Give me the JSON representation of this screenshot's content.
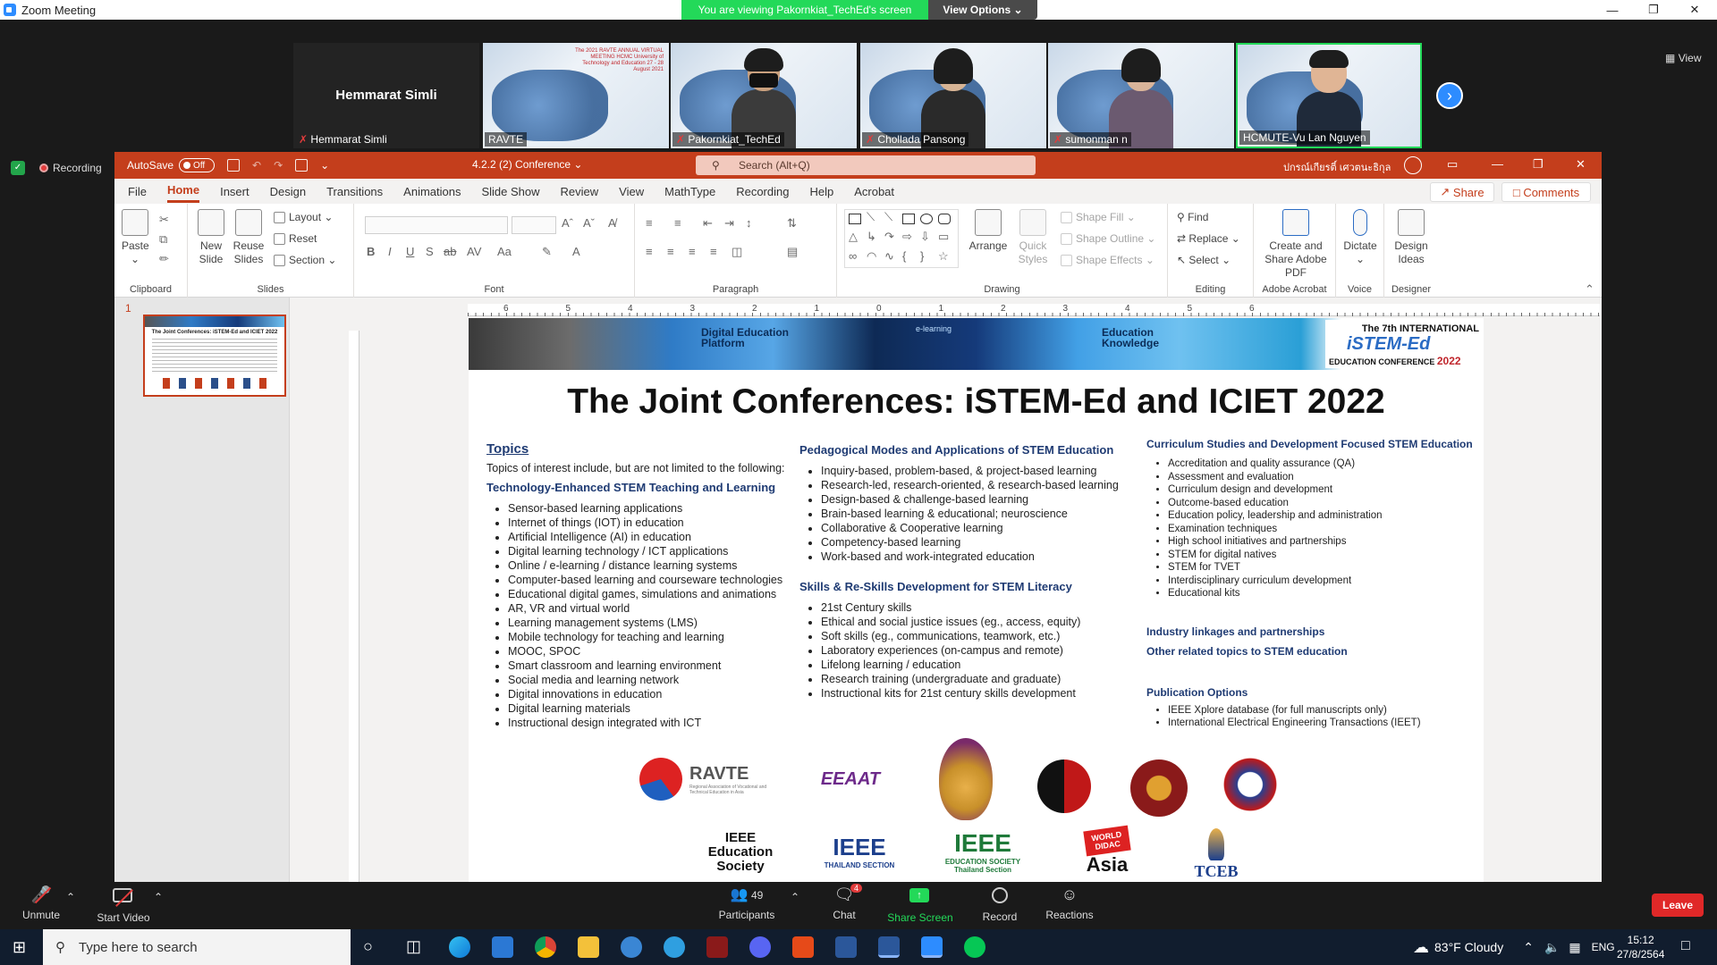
{
  "zoom": {
    "window_title": "Zoom Meeting",
    "viewing_banner": "You are viewing Pakornkiat_TechEd's screen",
    "view_options": "View Options",
    "view_button": "View",
    "recording_label": "Recording",
    "participants_tiles": [
      {
        "name": "Hemmarat Simli",
        "label": "Hemmarat Simli",
        "type": "name-only"
      },
      {
        "name": "RAVTE",
        "type": "slide"
      },
      {
        "name": "Pakornkiat_TechEd",
        "type": "person-mask"
      },
      {
        "name": "Chollada Pansong",
        "type": "person"
      },
      {
        "name": "sumonman n",
        "type": "person"
      },
      {
        "name": "HCMUTE-Vu Lan Nguyen",
        "type": "person"
      }
    ],
    "tile_slide_title": "The 2021 RAVTE ANNUAL VIRTUAL MEETING HCMC University of Technology and Education 27 - 28 August 2021",
    "toolbar": {
      "unmute": "Unmute",
      "start_video": "Start Video",
      "participants": "Participants",
      "participants_count": "49",
      "chat": "Chat",
      "chat_badge": "4",
      "share_screen": "Share Screen",
      "record": "Record",
      "reactions": "Reactions",
      "leave": "Leave"
    }
  },
  "ppt": {
    "autosave": "AutoSave",
    "autosave_state": "Off",
    "doc_name": "4.2.2 (2) Conference",
    "search_placeholder": "Search (Alt+Q)",
    "user_name": "ปกรณ์เกียรติ์ เศวตนะธิกุล",
    "menu": [
      "File",
      "Home",
      "Insert",
      "Design",
      "Transitions",
      "Animations",
      "Slide Show",
      "Review",
      "View",
      "MathType",
      "Recording",
      "Help",
      "Acrobat"
    ],
    "active_menu": "Home",
    "share": "Share",
    "comments": "Comments",
    "ribbon": {
      "clipboard": {
        "label": "Clipboard",
        "paste": "Paste"
      },
      "slides": {
        "label": "Slides",
        "new_slide": "New Slide",
        "reuse": "Reuse Slides",
        "layout": "Layout",
        "reset": "Reset",
        "section": "Section"
      },
      "font": {
        "label": "Font"
      },
      "paragraph": {
        "label": "Paragraph"
      },
      "drawing": {
        "label": "Drawing",
        "arrange": "Arrange",
        "quick_styles": "Quick Styles",
        "shape_fill": "Shape Fill",
        "shape_outline": "Shape Outline",
        "shape_effects": "Shape Effects"
      },
      "editing": {
        "label": "Editing",
        "find": "Find",
        "replace": "Replace",
        "select": "Select"
      },
      "acrobat": {
        "label": "Adobe Acrobat",
        "create": "Create and Share Adobe PDF"
      },
      "voice": {
        "label": "Voice",
        "dictate": "Dictate"
      },
      "designer": {
        "label": "Designer",
        "ideas": "Design Ideas"
      }
    },
    "ruler_ticks": [
      "6",
      "5",
      "4",
      "3",
      "2",
      "1",
      "0",
      "1",
      "2",
      "3",
      "4",
      "5",
      "6"
    ],
    "slide_number": "1",
    "thumb_title": "The Joint Conferences: iSTEM-Ed and ICIET 2022"
  },
  "slide": {
    "banner": {
      "digital_platform": "Digital Education Platform",
      "knowledge": "Education Knowledge",
      "elearning": "e-learning",
      "conf_line1": "The 7th INTERNATIONAL",
      "conf_logo": "iSTEM-Ed",
      "conf_line2": "EDUCATION CONFERENCE",
      "conf_year": "2022"
    },
    "title": "The Joint Conferences: iSTEM-Ed and ICIET 2022",
    "col1": {
      "topics": "Topics",
      "intro": "Topics of interest include, but are not limited to the following:",
      "heading": "Technology-Enhanced STEM Teaching and Learning",
      "items": [
        "Sensor-based learning applications",
        "Internet of things (IOT) in education",
        "Artificial Intelligence (AI) in education",
        "Digital learning technology / ICT applications",
        "Online / e-learning / distance learning systems",
        "Computer-based learning and courseware technologies",
        "Educational digital games, simulations and animations",
        "AR, VR and virtual world",
        "Learning management systems (LMS)",
        "Mobile technology for teaching and learning",
        "MOOC, SPOC",
        "Smart classroom and learning environment",
        "Social media and learning network",
        "Digital innovations in education",
        "Digital learning materials",
        "Instructional design integrated with ICT"
      ]
    },
    "col2": {
      "heading1": "Pedagogical Modes and Applications of STEM Education",
      "items1": [
        "Inquiry-based, problem-based, & project-based learning",
        "Research-led, research-oriented, & research-based learning",
        "Design-based & challenge-based learning",
        "Brain-based learning & educational; neuroscience",
        "Collaborative & Cooperative learning",
        "Competency-based learning",
        "Work-based and work-integrated education"
      ],
      "heading2": "Skills & Re-Skills Development for STEM Literacy",
      "items2": [
        "21st Century skills",
        "Ethical and social justice issues (eg., access, equity)",
        "Soft skills (eg., communications, teamwork, etc.)",
        "Laboratory experiences (on-campus and remote)",
        "Lifelong learning / education",
        "Research training (undergraduate and graduate)",
        "Instructional kits for 21st century skills development"
      ]
    },
    "col3": {
      "heading1": "Curriculum Studies and Development Focused STEM Education",
      "items1": [
        "Accreditation and quality assurance (QA)",
        "Assessment and evaluation",
        "Curriculum design and development",
        "Outcome-based education",
        "Education policy, leadership and administration",
        "Examination techniques",
        "High school initiatives and partnerships",
        "STEM for digital natives",
        "STEM for TVET",
        "Interdisciplinary curriculum development",
        "Educational kits"
      ],
      "industry": "Industry linkages and partnerships",
      "other": "Other related topics to STEM education",
      "pub_heading": "Publication Options",
      "pub_items": [
        "IEEE Xplore database (for full manuscripts only)",
        "International Electrical Engineering Transactions (IEET)"
      ]
    },
    "logos": {
      "ravte": "RAVTE",
      "ravte_sub": "Regional Association of Vocational and Technical Education in Asia",
      "eeaat": "EEAAT",
      "ieee_edu": "IEEE Education Society",
      "ieee_th": "IEEE",
      "ieee_th_sub": "THAILAND SECTION",
      "ieee_es": "IEEE",
      "ieee_es_sub": "EDUCATION SOCIETY Thailand Section",
      "worlddidac": "WORLD DIDAC",
      "asia": "Asia",
      "tceb": "TCEB"
    }
  },
  "taskbar": {
    "search_placeholder": "Type here to search",
    "weather": "83°F  Cloudy",
    "lang": "ENG",
    "time": "15:12",
    "date": "27/8/2564"
  },
  "colors": {
    "ppt_accent": "#c43e1c",
    "zoom_green": "#23d959",
    "zoom_blue": "#2d8cff"
  }
}
